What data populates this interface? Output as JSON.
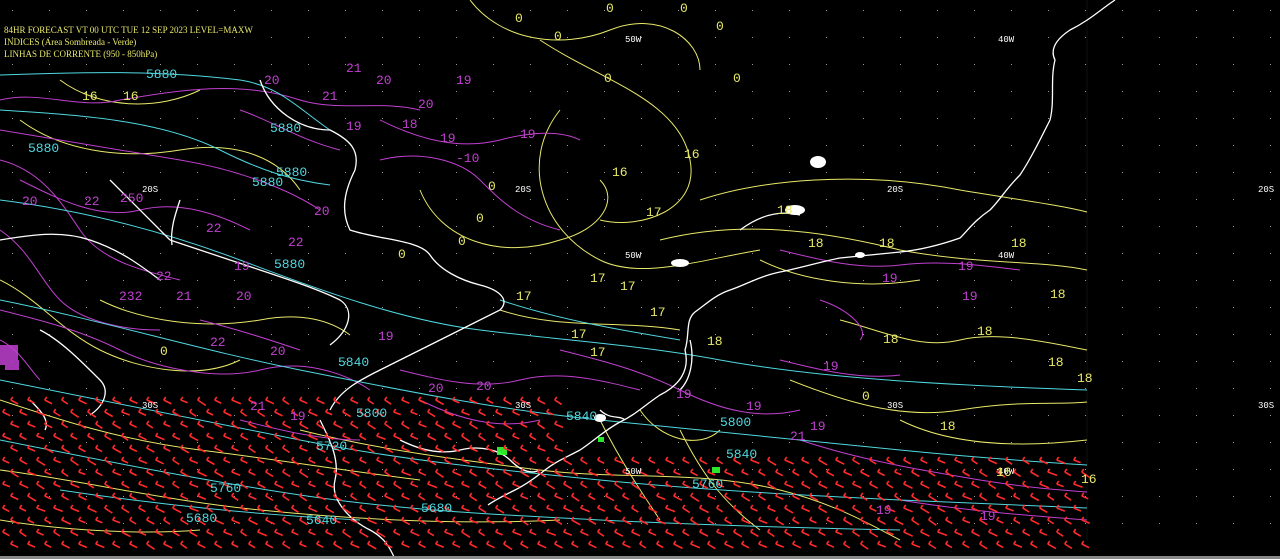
{
  "header": {
    "line1": "84HR FORECAST   VT 00 UTC TUE 12 SEP 2023   LEVEL=MAXW",
    "line2": "INDICES (Area Sombreada - Verde)",
    "line3": "LINHAS DE CORRENTE (950 - 850hPa)"
  },
  "grid_labels": {
    "lon_50w": "50W",
    "lon_40w": "40W",
    "lat_20s": "20S",
    "lat_30s": "30S"
  },
  "colors": {
    "coast": "#ffffff",
    "yellow": "#e8e86a",
    "magenta": "#c040d0",
    "cyan": "#50d8e0",
    "red": "#ff2a2a",
    "green": "#30ff30"
  },
  "contour_labels": {
    "yellow": [
      "0",
      "0",
      "0",
      "0",
      "0",
      "16",
      "16",
      "16",
      "16",
      "17",
      "17",
      "17",
      "17",
      "17",
      "17",
      "18",
      "18",
      "18",
      "18",
      "18",
      "18",
      "18",
      "18",
      "18",
      "18",
      "16",
      "16",
      "0",
      "0",
      "0",
      "0",
      "0",
      "0",
      "17",
      "18",
      "0",
      "0"
    ],
    "magenta": [
      "20",
      "19",
      "20",
      "21",
      "20",
      "19",
      "19",
      "19",
      "18",
      "19",
      "-10",
      "21",
      "20",
      "22",
      "250",
      "22",
      "20",
      "19",
      "22",
      "22",
      "21",
      "20",
      "22",
      "232",
      "20",
      "19",
      "21",
      "19",
      "20",
      "20",
      "19",
      "19",
      "19",
      "19",
      "19",
      "21",
      "19",
      "19",
      "19"
    ],
    "cyan": [
      "5880",
      "5880",
      "5880",
      "5880",
      "5880",
      "5880",
      "5840",
      "5800",
      "5840",
      "5800",
      "5840",
      "5760",
      "5760",
      "5680",
      "5640",
      "5680",
      "5720"
    ]
  }
}
